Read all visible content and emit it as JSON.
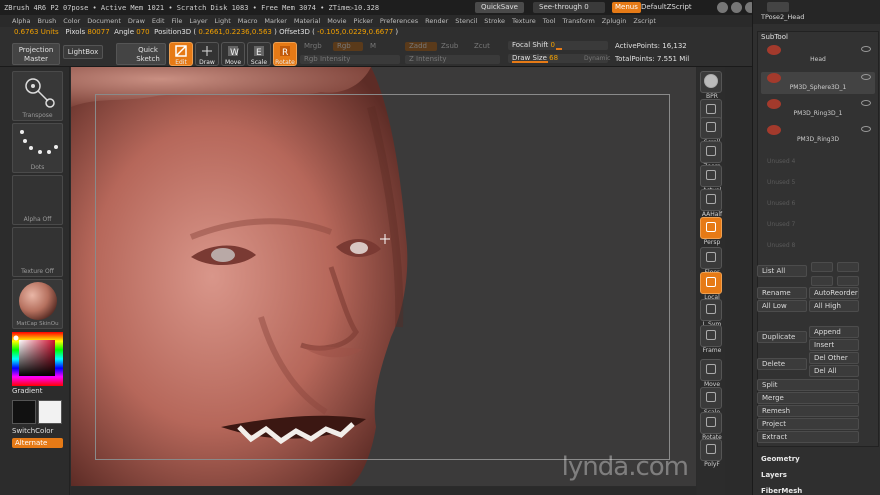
{
  "titlebar": {
    "title": "ZBrush 4R6 P2   07pose   • Active Mem 1021  • Scratch Disk 1083  • Free Mem 3074  • ZTime▷10.328",
    "quicksave": "QuickSave",
    "seethrough": "See-through  0",
    "menus": "Menus",
    "zscript": "DefaultZScript"
  },
  "menubar": [
    "Alpha",
    "Brush",
    "Color",
    "Document",
    "Draw",
    "Edit",
    "File",
    "Layer",
    "Light",
    "Macro",
    "Marker",
    "Material",
    "Movie",
    "Picker",
    "Preferences",
    "Render",
    "Stencil",
    "Stroke",
    "Texture",
    "Tool",
    "Transform",
    "Zplugin",
    "Zscript"
  ],
  "info": {
    "units": "0.6763 Units",
    "pixols_label": "Pixols",
    "pixols": "80077",
    "angle_label": "Angle",
    "angle": "070",
    "position_label": "Position3D (",
    "position": "0.2661,0.2236,0.563",
    "offset_label": ") Offset3D (",
    "offset": "-0.105,0.0229,0.6677",
    "close": ")"
  },
  "shelf": {
    "projection_master": "Projection\nMaster",
    "lightbox": "LightBox",
    "quick_sketch": "Quick\nSketch",
    "edit": "Edit",
    "draw": "Draw",
    "move": "Move",
    "scale": "Scale",
    "rotate": "Rotate",
    "mrgb": "Mrgb",
    "rgb": "Rgb",
    "m": "M",
    "zadd": "Zadd",
    "zsub": "Zsub",
    "zcut": "Zcut",
    "rgb_intensity": "Rgb  Intensity",
    "z_intensity": "Z Intensity",
    "focal_shift": "Focal Shift",
    "focal_value": "0",
    "draw_size": "Draw Size",
    "draw_value": "68",
    "dynamic": "Dynamic",
    "active_points": "ActivePoints: 16,132",
    "total_points": "TotalPoints: 7.551  Mil"
  },
  "lefttray": {
    "transpose": "Transpose",
    "dots": "Dots",
    "alpha": "Alpha  Off",
    "texture": "Texture  Off",
    "matcap": "MatCap  SkinOu",
    "gradient": "Gradient",
    "switchcolor": "SwitchColor",
    "alternate": "Alternate"
  },
  "righttools": [
    "BPR",
    "SPix",
    "Scroll",
    "Zoom",
    "Actual",
    "AAHalf",
    "Persp",
    "Floor",
    "Local",
    "L.Sym",
    "Frame",
    "Move",
    "Scale",
    "Rotate",
    "PolyF"
  ],
  "subtool": {
    "top_name": "TPose2_Head",
    "title": "SubTool",
    "items": [
      {
        "name": "Head"
      },
      {
        "name": "PM3D_Sphere3D_1"
      },
      {
        "name": "PM3D_Ring3D_1"
      },
      {
        "name": "PM3D_Ring3D"
      }
    ],
    "unused": [
      "Unused 4",
      "Unused 5",
      "Unused 6",
      "Unused 7",
      "Unused 8"
    ],
    "list_all": "List All",
    "rename": "Rename",
    "autoreorder": "AutoReorder",
    "all_low": "All Low",
    "all_high": "All High",
    "duplicate": "Duplicate",
    "append": "Append",
    "insert": "Insert",
    "delete": "Delete",
    "del_other": "Del Other",
    "del_all": "Del All",
    "split": "Split",
    "merge": "Merge",
    "remesh": "Remesh",
    "project": "Project",
    "extract": "Extract",
    "geometry": "Geometry",
    "layers": "Layers",
    "fibermesh": "FiberMesh"
  },
  "watermark": "lynda.com",
  "colors": {
    "accent": "#e67a16",
    "panel": "#2f2f2f",
    "canvas": "#3b3a3a"
  }
}
